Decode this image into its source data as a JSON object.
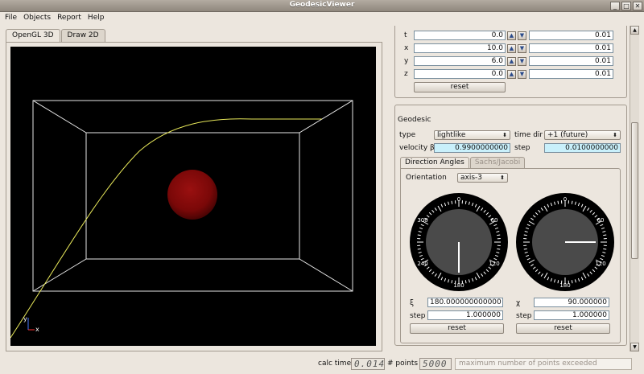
{
  "window": {
    "title": "GeodesicViewer"
  },
  "menu": [
    "File",
    "Objects",
    "Report",
    "Help"
  ],
  "view_tabs": [
    "OpenGL 3D",
    "Draw 2D"
  ],
  "axes_labels": {
    "y": "y",
    "x": "x"
  },
  "coords": {
    "rows": [
      {
        "label": "t",
        "value": "0.0",
        "step": "0.01"
      },
      {
        "label": "x",
        "value": "10.0",
        "step": "0.01"
      },
      {
        "label": "y",
        "value": "6.0",
        "step": "0.01"
      },
      {
        "label": "z",
        "value": "0.0",
        "step": "0.01"
      }
    ],
    "reset_label": "reset",
    "spin_up": "▲",
    "spin_down": "▼"
  },
  "geodesic": {
    "title": "Geodesic",
    "type_label": "type",
    "type_value": "lightlike",
    "time_dir_label": "time dir",
    "time_dir_value": "+1 (future)",
    "velocity_label": "velocity β",
    "velocity_value": "0.9900000000",
    "step_label": "step",
    "step_value": "0.0100000000",
    "tabs": [
      "Direction Angles",
      "Sachs/Jacobi"
    ],
    "orientation_label": "Orientation",
    "orientation_value": "axis-3",
    "dial1": {
      "ticks": [
        "0",
        "60",
        "120",
        "180",
        "240",
        "300"
      ],
      "angle_deg": 180
    },
    "dial2": {
      "ticks": [
        "0",
        "60",
        "120",
        "180"
      ],
      "angle_deg": 90
    },
    "xi": {
      "label": "ξ",
      "value": "180.000000000000",
      "step_label": "step",
      "step_value": "1.000000",
      "reset_label": "reset"
    },
    "chi": {
      "label": "χ",
      "value": "90.000000",
      "step_label": "step",
      "step_value": "1.000000",
      "reset_label": "reset"
    }
  },
  "status": {
    "calc_time_label": "calc time",
    "calc_time_value": "0.014",
    "points_label": "# points",
    "points_value": "5000",
    "message": "maximum number of points exceeded"
  },
  "colors": {
    "curve": "#e8e85a",
    "sphere": "#8a0a0a",
    "box": "#e6e6e6",
    "field_cyan": "#c9f0fb"
  }
}
